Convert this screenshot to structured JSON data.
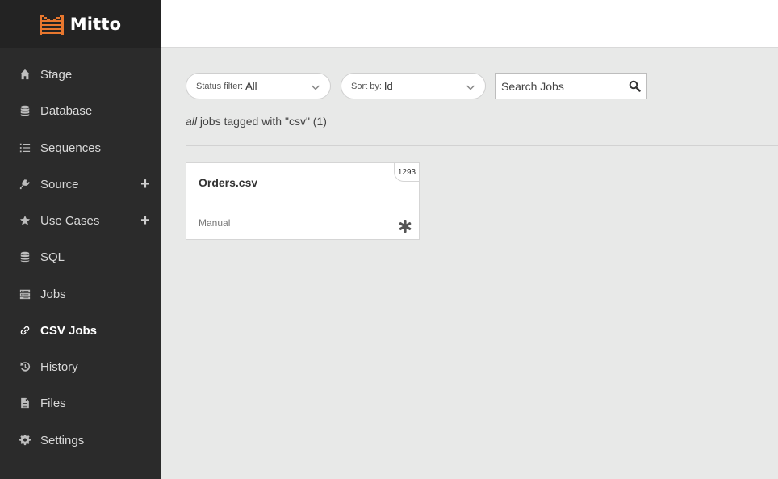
{
  "brand": {
    "name": "Mitto",
    "logo_color": "#e8772e"
  },
  "sidebar": {
    "items": [
      {
        "label": "Stage",
        "icon": "home-icon"
      },
      {
        "label": "Database",
        "icon": "database-icon"
      },
      {
        "label": "Sequences",
        "icon": "list-icon"
      },
      {
        "label": "Source",
        "icon": "plug-icon",
        "expandable": true
      },
      {
        "label": "Use Cases",
        "icon": "star-icon",
        "expandable": true
      },
      {
        "label": "SQL",
        "icon": "database-icon"
      },
      {
        "label": "Jobs",
        "icon": "server-icon"
      },
      {
        "label": "CSV Jobs",
        "icon": "link-icon",
        "active": true
      },
      {
        "label": "History",
        "icon": "history-icon"
      },
      {
        "label": "Files",
        "icon": "file-icon"
      },
      {
        "label": "Settings",
        "icon": "gear-icon"
      }
    ],
    "plus_symbol": "+"
  },
  "filters": {
    "status": {
      "prefix": "Status filter:",
      "value": "All"
    },
    "sort": {
      "prefix": "Sort by:",
      "value": "Id"
    },
    "search": {
      "placeholder": "Search Jobs"
    }
  },
  "summary": {
    "scope": "all",
    "text": " jobs tagged with \"csv\" (1)"
  },
  "jobs": [
    {
      "title": "Orders.csv",
      "schedule": "Manual",
      "id": "1293"
    }
  ]
}
